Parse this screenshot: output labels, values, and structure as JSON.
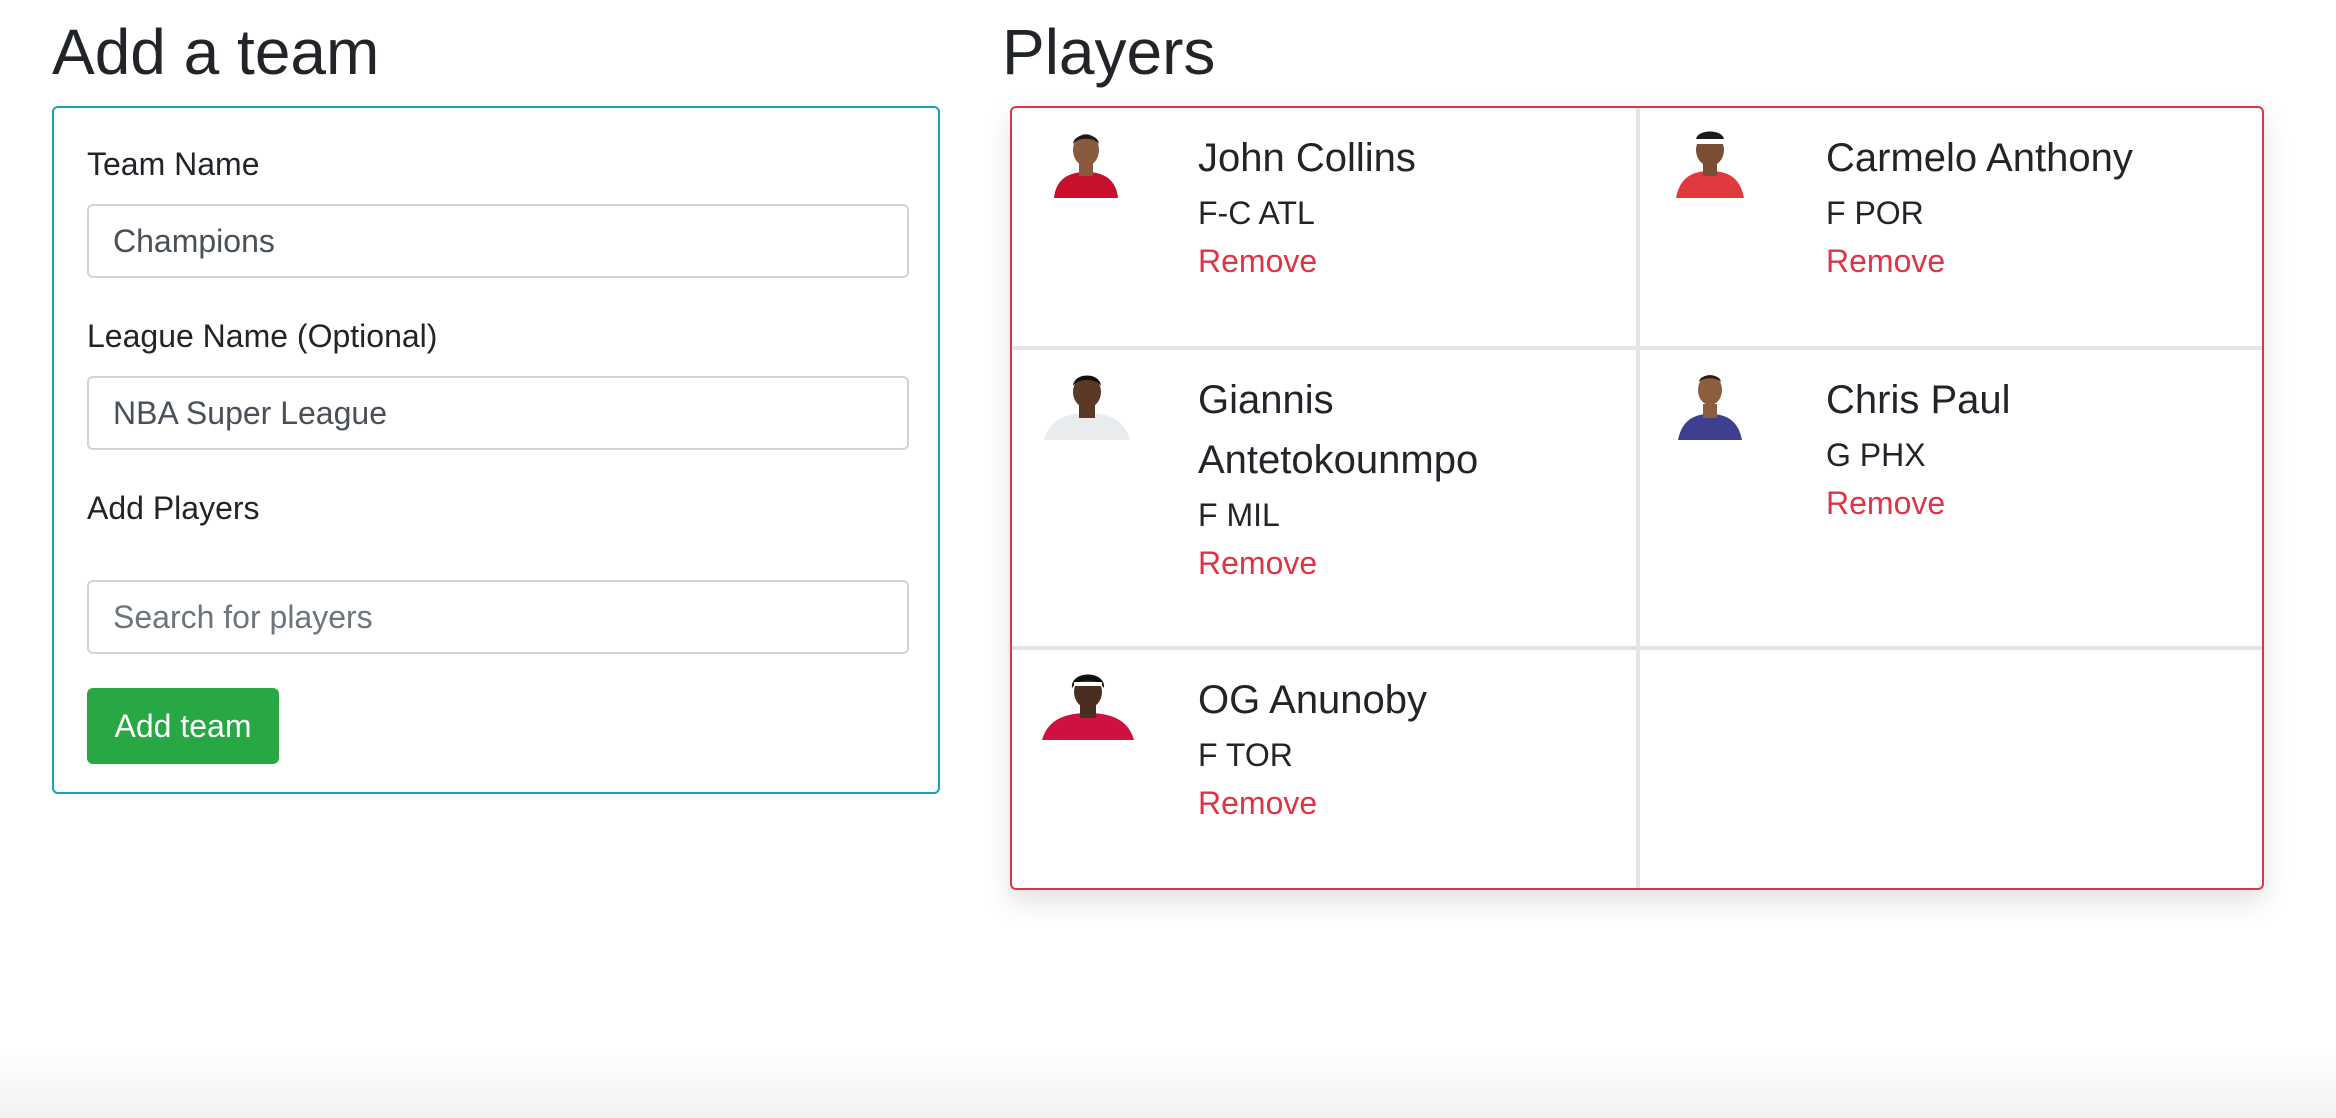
{
  "add_team": {
    "heading": "Add a team",
    "team_name_label": "Team Name",
    "team_name_value": "Champions",
    "league_name_label": "League Name (Optional)",
    "league_name_value": "NBA Super League",
    "add_players_label": "Add Players",
    "search_placeholder": "Search for players",
    "submit_label": "Add team"
  },
  "players": {
    "heading": "Players",
    "list": [
      {
        "name": "John Collins",
        "position": "F-C ATL",
        "remove_label": "Remove",
        "skin": "#8a5a3c",
        "jersey": "#c8102e"
      },
      {
        "name": "Carmelo Anthony",
        "position": "F POR",
        "remove_label": "Remove",
        "skin": "#7a4e34",
        "jersey": "#e03a3e"
      },
      {
        "name": "Giannis Antetokounmpo",
        "position": "F MIL",
        "remove_label": "Remove",
        "skin": "#5a3a26",
        "jersey": "#e8ecef"
      },
      {
        "name": "Chris Paul",
        "position": "G PHX",
        "remove_label": "Remove",
        "skin": "#8b5e40",
        "jersey": "#3f3f8f"
      },
      {
        "name": "OG Anunoby",
        "position": "F TOR",
        "remove_label": "Remove",
        "skin": "#4a2f20",
        "jersey": "#ce1141"
      }
    ]
  },
  "colors": {
    "form_border": "#17a2b8",
    "players_border": "#dc3545",
    "button_bg": "#28a745",
    "remove_link": "#dc3545"
  }
}
